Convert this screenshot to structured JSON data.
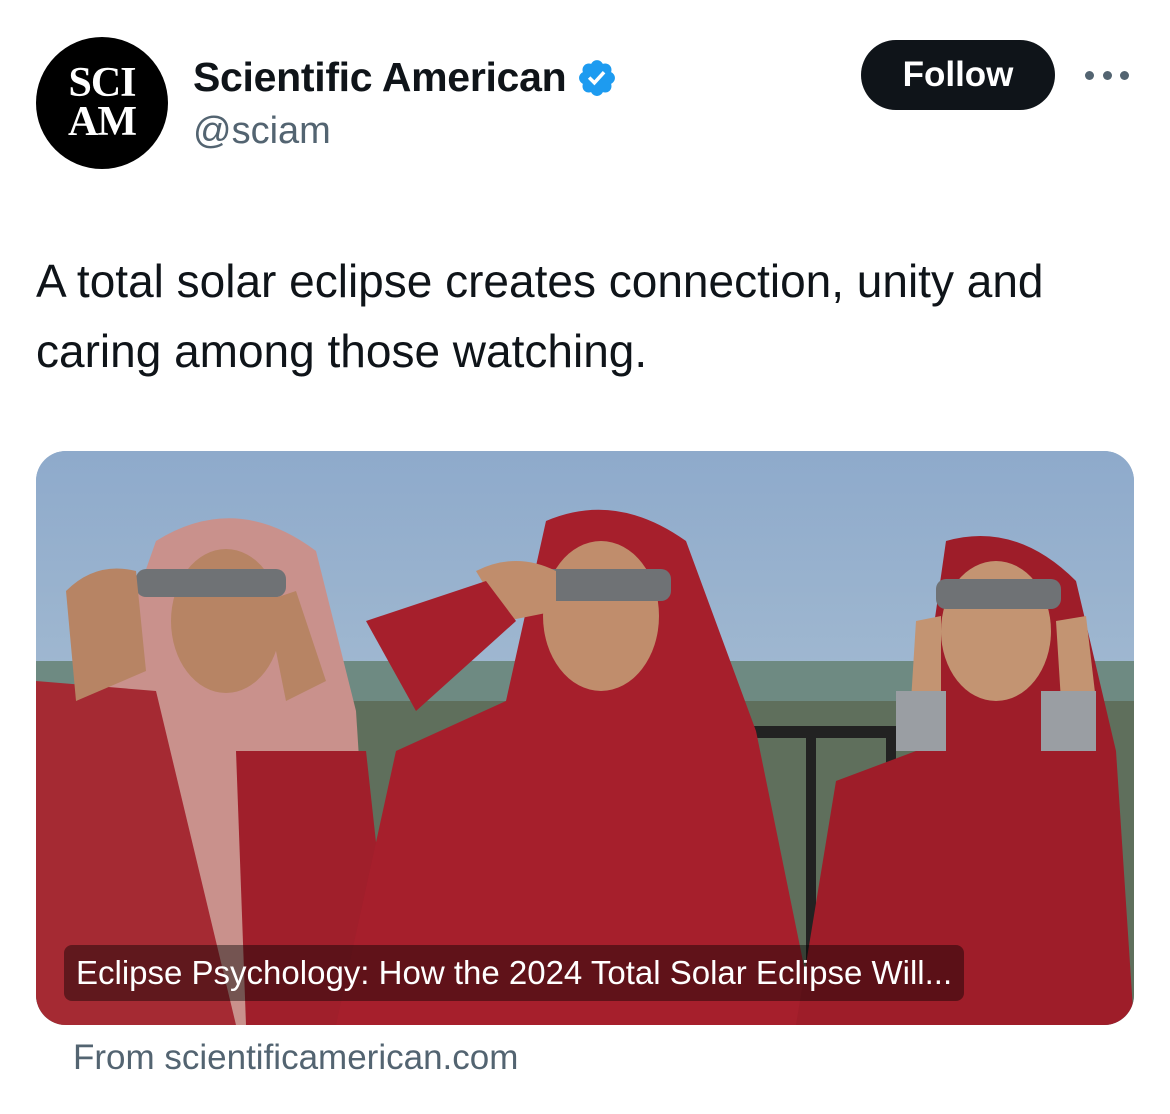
{
  "account": {
    "avatar_line1": "SCI",
    "avatar_line2": "AM",
    "display_name": "Scientific American",
    "handle": "@sciam",
    "verified": true,
    "verified_icon": "verified-badge-icon",
    "verified_color": "#1d9bf0"
  },
  "actions": {
    "follow_label": "Follow",
    "more_icon": "more-dots-icon"
  },
  "tweet": {
    "text": "A total solar eclipse creates connection, unity and caring among those watching."
  },
  "link_card": {
    "title": "Eclipse Psychology: How the 2024 Total Solar Eclipse Will...",
    "source": "From scientificamerican.com"
  },
  "colors": {
    "text_primary": "#0f1419",
    "text_secondary": "#536471",
    "follow_bg": "#0f1419"
  }
}
